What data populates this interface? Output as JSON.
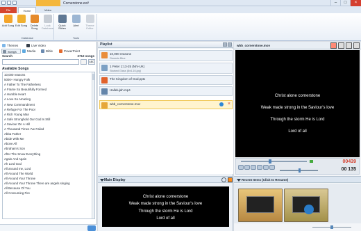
{
  "window": {
    "title": "Cornerstone.ev#"
  },
  "tabs": {
    "file": "File",
    "home": "Home",
    "video": "Video"
  },
  "ribbon": {
    "groups": [
      {
        "name": "Database",
        "buttons": [
          "Add Song",
          "Edit Song",
          "Delete Song",
          "Lock Database"
        ]
      },
      {
        "name": "Tools",
        "buttons": [
          "Quick Slides",
          "Alert",
          "Theme Editor"
        ]
      }
    ]
  },
  "left": {
    "section_tabs": {
      "themes": "Themes",
      "live_video": "Live Video",
      "songs": "Songs",
      "media": "Media",
      "bible": "Bible",
      "powerpoint": "PowerPoint"
    },
    "search_label": "Search",
    "song_count": "2712 songs",
    "search_filter": "ABC",
    "available_title": "Available Songs",
    "songs": [
      "10,000 reasons",
      "5000+ Hungry Folk",
      "A Father To The Fatherless",
      "A Frame So Beautifully Formed",
      "A Humble Heart",
      "A Love So Amazing",
      "A New Commandment",
      "A Refuge For The Poor",
      "A Rich Young Man",
      "A Safe Stronghold Our God Is Still",
      "A Saviour On A Hill",
      "A Thousand Times I've Failed",
      "Abba Father",
      "Abide With Me",
      "Above All",
      "Abraham's Son",
      "After The Snow Everything",
      "Again And Again",
      "Ah Lord God",
      "All around me, Lord",
      "All Around The World",
      "All Around Your Throne",
      "All Around Your Throne There are angels singing",
      "All Because Of You",
      "All Consuming Fire"
    ]
  },
  "playlist": {
    "title": "Playlist",
    "items": [
      {
        "name": "10,000 reasons",
        "sub": "Genesis Blue"
      },
      {
        "name": "1 Peter 1:13-25 (NIV-UK)",
        "sub": "Stained Glass  (8x4-16.jpg)"
      },
      {
        "name": "The Kingdom of God.pptx",
        "sub": ""
      },
      {
        "name": "Hallelujah.mp4",
        "sub": ""
      },
      {
        "name": "wbb_cornerstone.mov",
        "sub": ""
      }
    ]
  },
  "main_display": {
    "label": "Main Display",
    "lines": [
      "Christ alone cornerstone",
      "Weak made strong in the Saviour's love",
      "Through the storm He is Lord",
      "Lord of all"
    ]
  },
  "video": {
    "title": "wbb_cornerstone.mov",
    "lines": [
      "Christ alone cornerstone",
      "Weak made strong in the Saviour's love",
      "Through the storm He is Lord",
      "Lord of all"
    ],
    "timer_red": "00439",
    "timer_black": "00 135"
  },
  "recent": {
    "label": "Recent Items  (Click to Resume)"
  }
}
